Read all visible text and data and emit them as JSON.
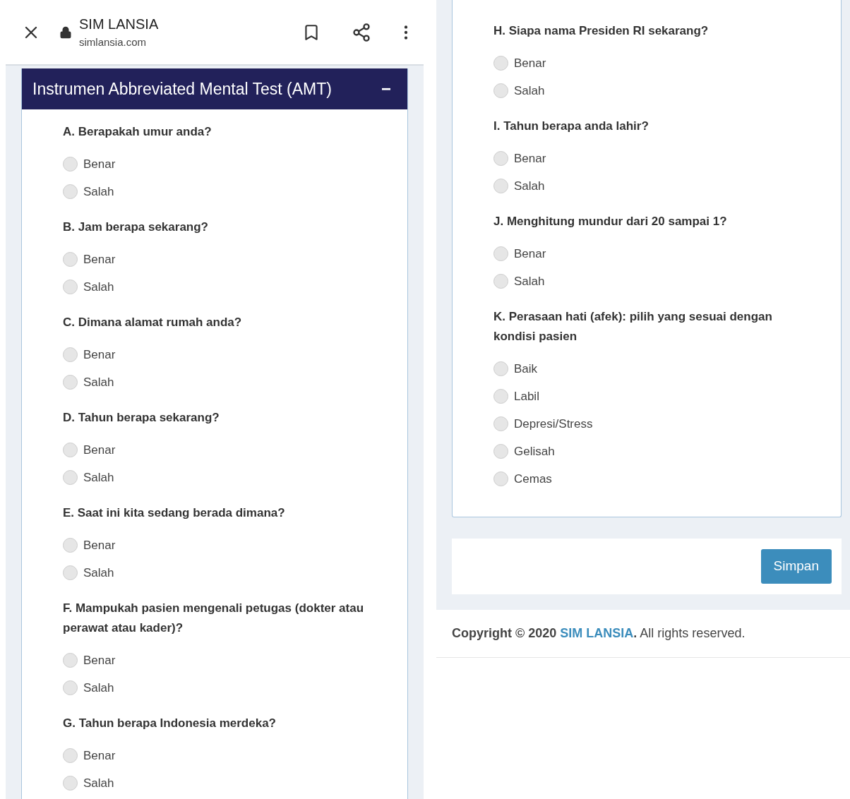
{
  "browser_bar": {
    "title": "SIM LANSIA",
    "url": "simlansia.com"
  },
  "form_panel": {
    "title": "Instrumen Abbreviated Mental Test (AMT)",
    "collapse_symbol": "−",
    "expanded": true,
    "questions": [
      {
        "text": "A. Berapakah umur anda?",
        "options": [
          {
            "label": "Benar",
            "selected": false
          },
          {
            "label": "Salah",
            "selected": false
          }
        ]
      },
      {
        "text": "B. Jam berapa sekarang?",
        "options": [
          {
            "label": "Benar",
            "selected": false
          },
          {
            "label": "Salah",
            "selected": false
          }
        ]
      },
      {
        "text": "C. Dimana alamat rumah anda?",
        "options": [
          {
            "label": "Benar",
            "selected": false
          },
          {
            "label": "Salah",
            "selected": false
          }
        ]
      },
      {
        "text": "D. Tahun berapa sekarang?",
        "options": [
          {
            "label": "Benar",
            "selected": false
          },
          {
            "label": "Salah",
            "selected": false
          }
        ]
      },
      {
        "text": "E. Saat ini kita sedang berada dimana?",
        "options": [
          {
            "label": "Benar",
            "selected": false
          },
          {
            "label": "Salah",
            "selected": false
          }
        ]
      },
      {
        "text": "F. Mampukah pasien mengenali petugas (dokter atau perawat atau kader)?",
        "options": [
          {
            "label": "Benar",
            "selected": false
          },
          {
            "label": "Salah",
            "selected": false
          }
        ]
      },
      {
        "text": "G. Tahun berapa Indonesia merdeka?",
        "options": [
          {
            "label": "Benar",
            "selected": false
          },
          {
            "label": "Salah",
            "selected": false
          }
        ]
      }
    ]
  },
  "form_panel_continued": {
    "questions": [
      {
        "text": "H. Siapa nama Presiden RI sekarang?",
        "options": [
          {
            "label": "Benar",
            "selected": false
          },
          {
            "label": "Salah",
            "selected": false
          }
        ]
      },
      {
        "text": "I. Tahun berapa anda lahir?",
        "options": [
          {
            "label": "Benar",
            "selected": false
          },
          {
            "label": "Salah",
            "selected": false
          }
        ]
      },
      {
        "text": "J. Menghitung mundur dari 20 sampai 1?",
        "options": [
          {
            "label": "Benar",
            "selected": false
          },
          {
            "label": "Salah",
            "selected": false
          }
        ]
      },
      {
        "text": "K. Perasaan hati (afek): pilih yang sesuai dengan kondisi pasien",
        "options": [
          {
            "label": "Baik",
            "selected": false
          },
          {
            "label": "Labil",
            "selected": false
          },
          {
            "label": "Depresi/Stress",
            "selected": false
          },
          {
            "label": "Gelisah",
            "selected": false
          },
          {
            "label": "Cemas",
            "selected": false
          }
        ]
      }
    ]
  },
  "save_button": "Simpan",
  "footer": {
    "prefix": "Copyright © 2020",
    "link": "SIM LANSIA",
    "suffix": "**.** All rights reserved."
  }
}
